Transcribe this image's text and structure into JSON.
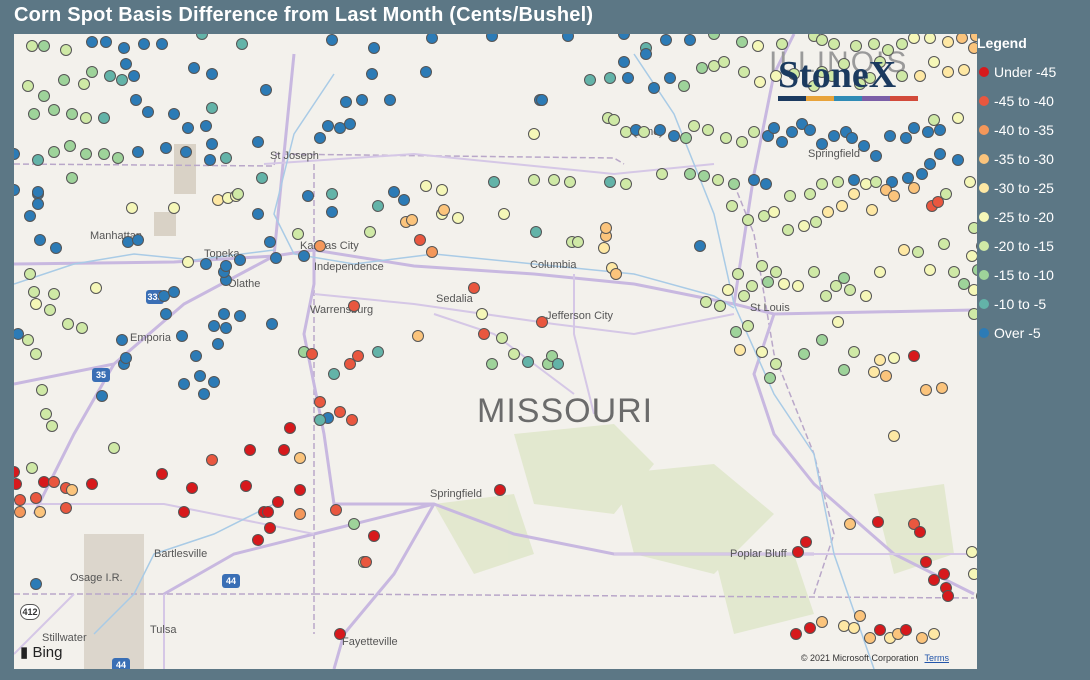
{
  "title": "Corn Spot Basis Difference from Last Month (Cents/Bushel)",
  "map": {
    "state_label": "MISSOURI",
    "state_label_2": "ILLINOIS",
    "attribution_brand": "Bing",
    "copyright": "© 2021 Microsoft Corporation",
    "terms_label": "Terms",
    "cities": [
      {
        "name": "St Joseph"
      },
      {
        "name": "Manhattan"
      },
      {
        "name": "Topeka"
      },
      {
        "name": "Kansas City"
      },
      {
        "name": "Independence"
      },
      {
        "name": "Olathe"
      },
      {
        "name": "Emporia"
      },
      {
        "name": "Warrensburg"
      },
      {
        "name": "Sedalia"
      },
      {
        "name": "Columbia"
      },
      {
        "name": "Jefferson City"
      },
      {
        "name": "St Louis"
      },
      {
        "name": "Quincy"
      },
      {
        "name": "Springfield"
      },
      {
        "name": "Springfield"
      },
      {
        "name": "Bartlesville"
      },
      {
        "name": "Osage I.R."
      },
      {
        "name": "Tulsa"
      },
      {
        "name": "Stillwater"
      },
      {
        "name": "Fayetteville"
      },
      {
        "name": "Poplar Bluff"
      }
    ],
    "highway_shields": [
      "335",
      "35",
      "44",
      "412",
      "44"
    ]
  },
  "logo": {
    "text": "StoneX"
  },
  "legend": {
    "title": "Legend",
    "items": [
      {
        "label": "Under -45",
        "color": "#d7191c"
      },
      {
        "label": "-45 to -40",
        "color": "#e9573f"
      },
      {
        "label": "-40 to -35",
        "color": "#f4975a"
      },
      {
        "label": "-35 to -30",
        "color": "#fbc47c"
      },
      {
        "label": "-30 to -25",
        "color": "#fee8a4"
      },
      {
        "label": "-25 to -20",
        "color": "#f5f7b8"
      },
      {
        "label": "-20 to -15",
        "color": "#cfe9a6"
      },
      {
        "label": "-15 to -10",
        "color": "#9ed39a"
      },
      {
        "label": "-10 to -5",
        "color": "#63b3a8"
      },
      {
        "label": "Over -5",
        "color": "#2c7bb6"
      }
    ]
  },
  "points": [
    [
      18,
      12,
      6
    ],
    [
      30,
      12,
      7
    ],
    [
      52,
      16,
      6
    ],
    [
      78,
      8,
      9
    ],
    [
      92,
      8,
      9
    ],
    [
      110,
      14,
      9
    ],
    [
      130,
      10,
      9
    ],
    [
      148,
      10,
      9
    ],
    [
      188,
      0,
      8
    ],
    [
      228,
      10,
      8
    ],
    [
      318,
      6,
      9
    ],
    [
      360,
      14,
      9
    ],
    [
      418,
      4,
      9
    ],
    [
      478,
      2,
      9
    ],
    [
      554,
      2,
      9
    ],
    [
      610,
      0,
      9
    ],
    [
      632,
      14,
      8
    ],
    [
      632,
      20,
      9
    ],
    [
      652,
      6,
      9
    ],
    [
      676,
      6,
      9
    ],
    [
      700,
      0,
      7
    ],
    [
      728,
      8,
      7
    ],
    [
      744,
      12,
      5
    ],
    [
      768,
      10,
      6
    ],
    [
      800,
      2,
      6
    ],
    [
      808,
      6,
      6
    ],
    [
      820,
      10,
      6
    ],
    [
      842,
      12,
      6
    ],
    [
      860,
      10,
      6
    ],
    [
      874,
      16,
      6
    ],
    [
      888,
      10,
      6
    ],
    [
      900,
      4,
      5
    ],
    [
      916,
      4,
      5
    ],
    [
      934,
      8,
      4
    ],
    [
      948,
      4,
      3
    ],
    [
      962,
      2,
      3
    ],
    [
      14,
      52,
      6
    ],
    [
      30,
      62,
      7
    ],
    [
      50,
      46,
      7
    ],
    [
      70,
      50,
      6
    ],
    [
      78,
      38,
      7
    ],
    [
      96,
      42,
      8
    ],
    [
      108,
      46,
      8
    ],
    [
      112,
      30,
      9
    ],
    [
      120,
      42,
      9
    ],
    [
      180,
      34,
      9
    ],
    [
      198,
      40,
      9
    ],
    [
      252,
      56,
      9
    ],
    [
      332,
      68,
      9
    ],
    [
      348,
      66,
      9
    ],
    [
      358,
      40,
      9
    ],
    [
      376,
      66,
      9
    ],
    [
      412,
      38,
      9
    ],
    [
      526,
      66,
      9
    ],
    [
      576,
      46,
      8
    ],
    [
      596,
      44,
      8
    ],
    [
      610,
      28,
      9
    ],
    [
      614,
      44,
      9
    ],
    [
      640,
      54,
      9
    ],
    [
      656,
      44,
      9
    ],
    [
      670,
      52,
      7
    ],
    [
      688,
      34,
      7
    ],
    [
      700,
      32,
      6
    ],
    [
      710,
      28,
      6
    ],
    [
      730,
      38,
      6
    ],
    [
      746,
      48,
      5
    ],
    [
      762,
      42,
      5
    ],
    [
      780,
      40,
      6
    ],
    [
      800,
      52,
      6
    ],
    [
      808,
      38,
      6
    ],
    [
      818,
      42,
      6
    ],
    [
      830,
      30,
      6
    ],
    [
      846,
      50,
      6
    ],
    [
      856,
      44,
      6
    ],
    [
      866,
      28,
      6
    ],
    [
      888,
      42,
      6
    ],
    [
      906,
      42,
      4
    ],
    [
      920,
      28,
      5
    ],
    [
      934,
      38,
      4
    ],
    [
      950,
      36,
      4
    ],
    [
      960,
      14,
      3
    ],
    [
      20,
      80,
      7
    ],
    [
      40,
      76,
      7
    ],
    [
      58,
      80,
      7
    ],
    [
      72,
      84,
      6
    ],
    [
      90,
      84,
      8
    ],
    [
      122,
      66,
      9
    ],
    [
      134,
      78,
      9
    ],
    [
      160,
      80,
      9
    ],
    [
      174,
      94,
      9
    ],
    [
      192,
      92,
      9
    ],
    [
      198,
      74,
      8
    ],
    [
      198,
      110,
      9
    ],
    [
      244,
      108,
      9
    ],
    [
      306,
      104,
      9
    ],
    [
      314,
      92,
      9
    ],
    [
      326,
      94,
      9
    ],
    [
      336,
      90,
      9
    ],
    [
      528,
      66,
      9
    ],
    [
      520,
      100,
      5
    ],
    [
      594,
      84,
      6
    ],
    [
      600,
      86,
      6
    ],
    [
      612,
      98,
      6
    ],
    [
      622,
      96,
      9
    ],
    [
      630,
      98,
      6
    ],
    [
      646,
      96,
      9
    ],
    [
      660,
      102,
      9
    ],
    [
      672,
      104,
      7
    ],
    [
      680,
      92,
      6
    ],
    [
      694,
      96,
      6
    ],
    [
      712,
      104,
      6
    ],
    [
      728,
      108,
      6
    ],
    [
      740,
      98,
      6
    ],
    [
      754,
      102,
      9
    ],
    [
      760,
      94,
      9
    ],
    [
      768,
      108,
      9
    ],
    [
      778,
      98,
      9
    ],
    [
      788,
      90,
      9
    ],
    [
      796,
      96,
      9
    ],
    [
      808,
      110,
      9
    ],
    [
      820,
      102,
      9
    ],
    [
      832,
      98,
      9
    ],
    [
      838,
      104,
      9
    ],
    [
      850,
      112,
      9
    ],
    [
      862,
      122,
      9
    ],
    [
      876,
      102,
      9
    ],
    [
      892,
      104,
      9
    ],
    [
      900,
      94,
      9
    ],
    [
      914,
      98,
      9
    ],
    [
      920,
      86,
      6
    ],
    [
      926,
      96,
      9
    ],
    [
      944,
      84,
      5
    ],
    [
      24,
      126,
      8
    ],
    [
      40,
      118,
      7
    ],
    [
      56,
      112,
      7
    ],
    [
      72,
      120,
      7
    ],
    [
      90,
      120,
      7
    ],
    [
      104,
      124,
      7
    ],
    [
      124,
      118,
      9
    ],
    [
      152,
      114,
      9
    ],
    [
      172,
      118,
      9
    ],
    [
      196,
      126,
      9
    ],
    [
      212,
      124,
      8
    ],
    [
      248,
      144,
      8
    ],
    [
      318,
      160,
      8
    ],
    [
      364,
      172,
      8
    ],
    [
      380,
      158,
      9
    ],
    [
      390,
      166,
      9
    ],
    [
      428,
      156,
      5
    ],
    [
      480,
      148,
      8
    ],
    [
      520,
      146,
      6
    ],
    [
      540,
      146,
      6
    ],
    [
      556,
      148,
      6
    ],
    [
      596,
      148,
      8
    ],
    [
      612,
      150,
      6
    ],
    [
      648,
      140,
      6
    ],
    [
      676,
      140,
      7
    ],
    [
      690,
      142,
      7
    ],
    [
      704,
      146,
      6
    ],
    [
      720,
      150,
      7
    ],
    [
      740,
      146,
      9
    ],
    [
      752,
      150,
      9
    ],
    [
      776,
      162,
      6
    ],
    [
      796,
      160,
      6
    ],
    [
      808,
      150,
      6
    ],
    [
      824,
      148,
      6
    ],
    [
      840,
      146,
      9
    ],
    [
      852,
      150,
      5
    ],
    [
      862,
      148,
      6
    ],
    [
      878,
      148,
      9
    ],
    [
      894,
      144,
      9
    ],
    [
      908,
      140,
      9
    ],
    [
      916,
      130,
      9
    ],
    [
      926,
      120,
      9
    ],
    [
      944,
      126,
      9
    ],
    [
      24,
      160,
      9
    ],
    [
      24,
      170,
      9
    ],
    [
      24,
      158,
      9
    ],
    [
      58,
      144,
      7
    ],
    [
      118,
      174,
      5
    ],
    [
      160,
      174,
      5
    ],
    [
      204,
      166,
      4
    ],
    [
      214,
      164,
      5
    ],
    [
      222,
      162,
      5
    ],
    [
      224,
      160,
      6
    ],
    [
      244,
      180,
      9
    ],
    [
      294,
      162,
      9
    ],
    [
      318,
      178,
      9
    ],
    [
      392,
      188,
      3
    ],
    [
      398,
      186,
      3
    ],
    [
      412,
      152,
      5
    ],
    [
      428,
      180,
      5
    ],
    [
      444,
      184,
      5
    ],
    [
      490,
      180,
      5
    ],
    [
      522,
      198,
      8
    ],
    [
      590,
      214,
      4
    ],
    [
      592,
      202,
      3
    ],
    [
      592,
      194,
      3
    ],
    [
      598,
      234,
      4
    ],
    [
      686,
      212,
      9
    ],
    [
      718,
      172,
      6
    ],
    [
      734,
      186,
      6
    ],
    [
      750,
      182,
      6
    ],
    [
      760,
      178,
      5
    ],
    [
      774,
      196,
      6
    ],
    [
      790,
      192,
      5
    ],
    [
      802,
      188,
      6
    ],
    [
      814,
      178,
      4
    ],
    [
      828,
      172,
      4
    ],
    [
      840,
      160,
      4
    ],
    [
      858,
      176,
      4
    ],
    [
      872,
      156,
      3
    ],
    [
      880,
      162,
      3
    ],
    [
      900,
      154,
      3
    ],
    [
      918,
      172,
      1
    ],
    [
      924,
      168,
      1
    ],
    [
      932,
      160,
      6
    ],
    [
      956,
      148,
      5
    ],
    [
      0,
      120,
      9
    ],
    [
      0,
      156,
      9
    ],
    [
      16,
      182,
      9
    ],
    [
      26,
      206,
      9
    ],
    [
      42,
      214,
      9
    ],
    [
      16,
      240,
      6
    ],
    [
      20,
      258,
      6
    ],
    [
      22,
      270,
      5
    ],
    [
      40,
      260,
      6
    ],
    [
      36,
      276,
      6
    ],
    [
      54,
      290,
      6
    ],
    [
      68,
      294,
      6
    ],
    [
      82,
      254,
      5
    ],
    [
      114,
      208,
      9
    ],
    [
      124,
      206,
      9
    ],
    [
      150,
      262,
      9
    ],
    [
      160,
      258,
      9
    ],
    [
      152,
      280,
      9
    ],
    [
      174,
      228,
      5
    ],
    [
      192,
      230,
      9
    ],
    [
      200,
      292,
      9
    ],
    [
      210,
      280,
      9
    ],
    [
      212,
      246,
      9
    ],
    [
      210,
      238,
      9
    ],
    [
      212,
      232,
      9
    ],
    [
      226,
      226,
      9
    ],
    [
      256,
      208,
      9
    ],
    [
      262,
      224,
      9
    ],
    [
      284,
      200,
      6
    ],
    [
      290,
      222,
      9
    ],
    [
      306,
      212,
      2
    ],
    [
      340,
      272,
      1
    ],
    [
      356,
      198,
      6
    ],
    [
      406,
      206,
      1
    ],
    [
      418,
      218,
      2
    ],
    [
      430,
      176,
      3
    ],
    [
      460,
      254,
      1
    ],
    [
      468,
      280,
      5
    ],
    [
      470,
      300,
      1
    ],
    [
      528,
      288,
      1
    ],
    [
      558,
      208,
      6
    ],
    [
      564,
      208,
      6
    ],
    [
      602,
      240,
      3
    ],
    [
      692,
      268,
      6
    ],
    [
      706,
      272,
      6
    ],
    [
      714,
      256,
      5
    ],
    [
      724,
      240,
      6
    ],
    [
      730,
      262,
      6
    ],
    [
      738,
      252,
      6
    ],
    [
      748,
      232,
      6
    ],
    [
      754,
      248,
      7
    ],
    [
      762,
      238,
      6
    ],
    [
      770,
      250,
      5
    ],
    [
      784,
      252,
      5
    ],
    [
      800,
      238,
      6
    ],
    [
      812,
      262,
      6
    ],
    [
      822,
      252,
      6
    ],
    [
      830,
      244,
      7
    ],
    [
      836,
      256,
      6
    ],
    [
      852,
      262,
      5
    ],
    [
      866,
      238,
      5
    ],
    [
      890,
      216,
      4
    ],
    [
      904,
      218,
      6
    ],
    [
      916,
      236,
      5
    ],
    [
      930,
      210,
      6
    ],
    [
      940,
      238,
      6
    ],
    [
      950,
      250,
      7
    ],
    [
      958,
      222,
      5
    ],
    [
      960,
      194,
      6
    ],
    [
      960,
      256,
      5
    ],
    [
      960,
      280,
      6
    ],
    [
      964,
      236,
      7
    ],
    [
      968,
      212,
      8
    ],
    [
      4,
      300,
      9
    ],
    [
      14,
      306,
      6
    ],
    [
      22,
      320,
      6
    ],
    [
      28,
      356,
      6
    ],
    [
      32,
      380,
      6
    ],
    [
      38,
      392,
      6
    ],
    [
      88,
      362,
      9
    ],
    [
      108,
      306,
      9
    ],
    [
      110,
      330,
      9
    ],
    [
      112,
      324,
      9
    ],
    [
      168,
      302,
      9
    ],
    [
      170,
      350,
      9
    ],
    [
      182,
      322,
      9
    ],
    [
      186,
      342,
      9
    ],
    [
      190,
      360,
      9
    ],
    [
      200,
      348,
      9
    ],
    [
      204,
      310,
      9
    ],
    [
      212,
      294,
      9
    ],
    [
      226,
      282,
      9
    ],
    [
      258,
      290,
      9
    ],
    [
      290,
      318,
      7
    ],
    [
      298,
      320,
      1
    ],
    [
      320,
      340,
      8
    ],
    [
      336,
      330,
      1
    ],
    [
      344,
      322,
      1
    ],
    [
      306,
      368,
      1
    ],
    [
      314,
      384,
      9
    ],
    [
      306,
      386,
      8
    ],
    [
      326,
      378,
      1
    ],
    [
      338,
      386,
      1
    ],
    [
      364,
      318,
      8
    ],
    [
      404,
      302,
      3
    ],
    [
      478,
      330,
      7
    ],
    [
      488,
      304,
      6
    ],
    [
      500,
      320,
      6
    ],
    [
      514,
      328,
      8
    ],
    [
      534,
      330,
      7
    ],
    [
      538,
      322,
      7
    ],
    [
      544,
      330,
      8
    ],
    [
      722,
      298,
      7
    ],
    [
      726,
      316,
      4
    ],
    [
      734,
      292,
      6
    ],
    [
      748,
      318,
      5
    ],
    [
      756,
      344,
      7
    ],
    [
      762,
      330,
      6
    ],
    [
      790,
      320,
      7
    ],
    [
      808,
      306,
      7
    ],
    [
      824,
      288,
      5
    ],
    [
      830,
      336,
      7
    ],
    [
      840,
      318,
      6
    ],
    [
      860,
      338,
      4
    ],
    [
      866,
      326,
      4
    ],
    [
      872,
      342,
      3
    ],
    [
      880,
      324,
      5
    ],
    [
      900,
      322,
      0
    ],
    [
      912,
      356,
      3
    ],
    [
      928,
      354,
      3
    ],
    [
      0,
      438,
      0
    ],
    [
      2,
      450,
      0
    ],
    [
      6,
      466,
      1
    ],
    [
      6,
      478,
      2
    ],
    [
      18,
      434,
      6
    ],
    [
      22,
      464,
      1
    ],
    [
      26,
      478,
      3
    ],
    [
      30,
      448,
      0
    ],
    [
      40,
      448,
      1
    ],
    [
      52,
      454,
      1
    ],
    [
      52,
      474,
      1
    ],
    [
      58,
      456,
      3
    ],
    [
      78,
      450,
      0
    ],
    [
      100,
      414,
      6
    ],
    [
      148,
      440,
      0
    ],
    [
      170,
      478,
      0
    ],
    [
      178,
      454,
      0
    ],
    [
      198,
      426,
      1
    ],
    [
      232,
      452,
      0
    ],
    [
      236,
      416,
      0
    ],
    [
      244,
      506,
      0
    ],
    [
      250,
      478,
      0
    ],
    [
      254,
      478,
      0
    ],
    [
      256,
      494,
      0
    ],
    [
      264,
      468,
      0
    ],
    [
      270,
      416,
      0
    ],
    [
      276,
      394,
      0
    ],
    [
      286,
      424,
      3
    ],
    [
      286,
      456,
      0
    ],
    [
      286,
      480,
      2
    ],
    [
      322,
      476,
      1
    ],
    [
      340,
      490,
      7
    ],
    [
      350,
      528,
      6
    ],
    [
      352,
      528,
      1
    ],
    [
      360,
      502,
      0
    ],
    [
      486,
      456,
      0
    ],
    [
      784,
      518,
      0
    ],
    [
      792,
      508,
      0
    ],
    [
      836,
      490,
      3
    ],
    [
      864,
      488,
      0
    ],
    [
      880,
      402,
      4
    ],
    [
      900,
      490,
      1
    ],
    [
      906,
      498,
      0
    ],
    [
      912,
      528,
      0
    ],
    [
      920,
      546,
      0
    ],
    [
      930,
      540,
      0
    ],
    [
      932,
      554,
      0
    ],
    [
      934,
      562,
      0
    ],
    [
      958,
      518,
      5
    ],
    [
      960,
      540,
      5
    ],
    [
      968,
      562,
      5
    ],
    [
      972,
      584,
      5
    ],
    [
      22,
      550,
      9
    ],
    [
      326,
      600,
      0
    ],
    [
      782,
      600,
      0
    ],
    [
      796,
      594,
      0
    ],
    [
      808,
      588,
      3
    ],
    [
      830,
      592,
      4
    ],
    [
      840,
      594,
      4
    ],
    [
      846,
      582,
      3
    ],
    [
      856,
      604,
      3
    ],
    [
      866,
      596,
      0
    ],
    [
      876,
      604,
      4
    ],
    [
      884,
      600,
      3
    ],
    [
      892,
      596,
      0
    ],
    [
      908,
      604,
      3
    ],
    [
      920,
      600,
      4
    ]
  ]
}
